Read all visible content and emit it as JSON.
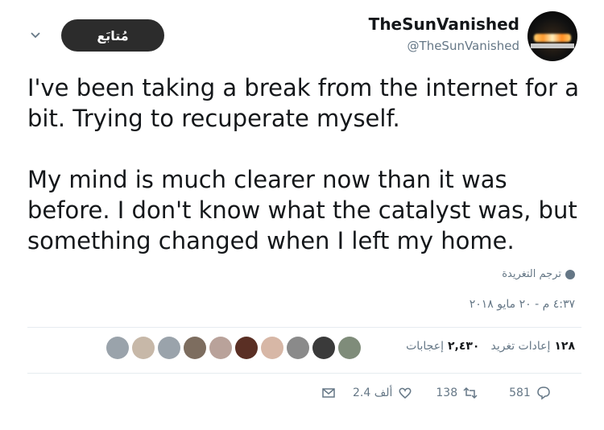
{
  "header": {
    "display_name": "TheSunVanished",
    "screen_name": "@TheSunVanished",
    "follow_label": "مُتابَع"
  },
  "tweet": {
    "paragraphs": [
      "I've been taking a break from the internet for a bit. Trying to recuperate myself.",
      "My mind is much clearer now than it was before. I don't know what the catalyst was, but something changed when I left my home."
    ],
    "translate_label": "ترجم التغريدة",
    "timestamp": "٤:٣٧ م - ٢٠ مايو ٢٠١٨"
  },
  "stats": {
    "retweets_count": "١٢٨",
    "retweets_label": "إعادات تغريد",
    "likes_count": "٢,٤٣٠",
    "likes_label": "إعجابات"
  },
  "likers": [
    "#9aa3ab",
    "#c7b8a8",
    "#9aa3ab",
    "#7d6d5f",
    "#b9a29a",
    "#5a2f24",
    "#d7b7a6",
    "#8a8a8a",
    "#3a3a3a",
    "#7f8c7a"
  ],
  "actions": {
    "likes": "2.4 ألف",
    "retweets": "138",
    "replies": "581"
  }
}
